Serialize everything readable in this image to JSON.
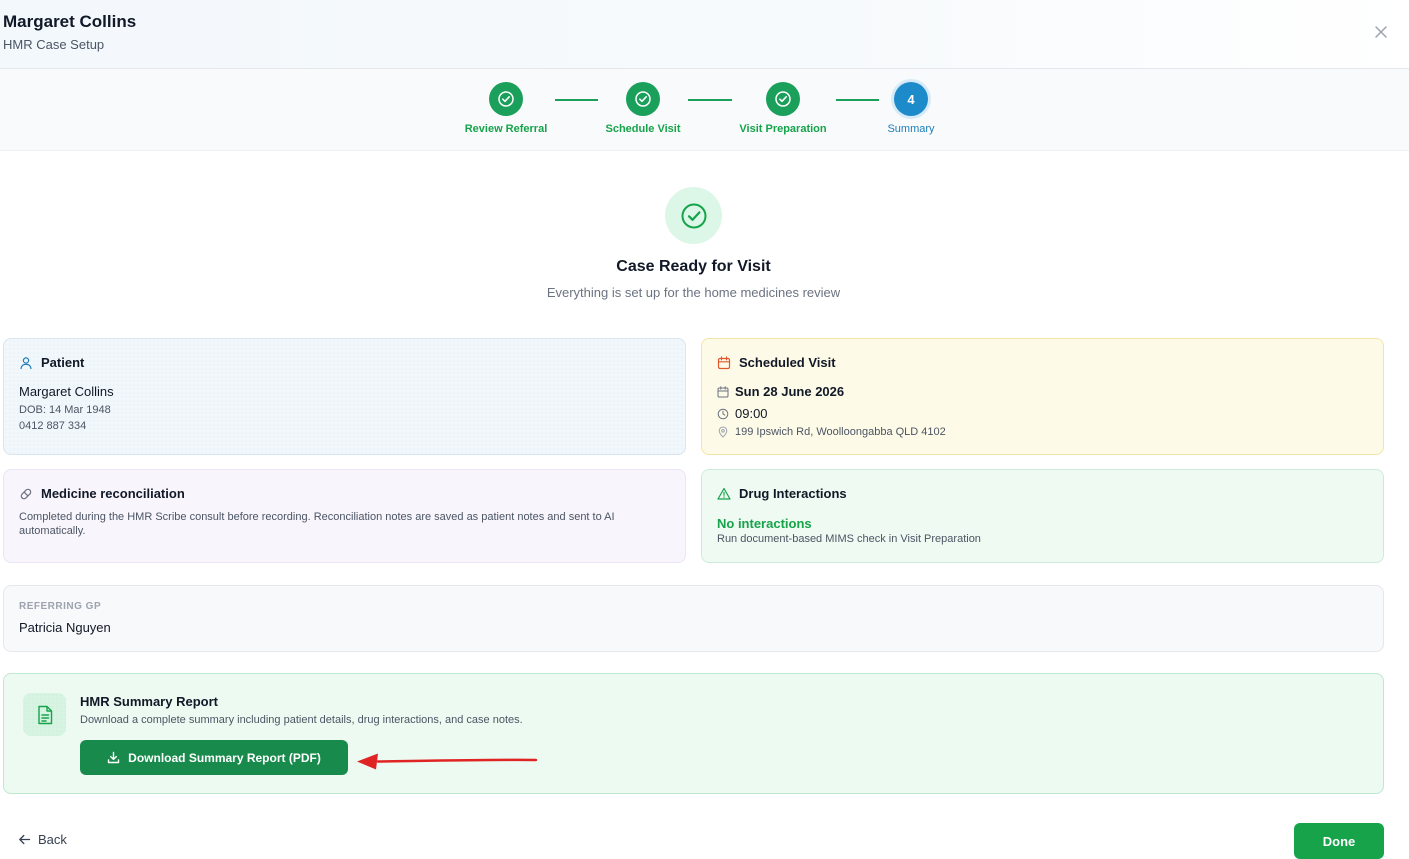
{
  "header": {
    "patient_name": "Margaret Collins",
    "subtitle": "HMR Case Setup"
  },
  "stepper": {
    "steps": [
      {
        "label": "Review Referral",
        "status": "complete"
      },
      {
        "label": "Schedule Visit",
        "status": "complete"
      },
      {
        "label": "Visit Preparation",
        "status": "complete"
      },
      {
        "label": "Summary",
        "status": "active",
        "number": "4"
      }
    ]
  },
  "hero": {
    "title": "Case Ready for Visit",
    "subtitle": "Everything is set up for the home medicines review"
  },
  "patient_card": {
    "title": "Patient",
    "name": "Margaret Collins",
    "dob": "DOB: 14 Mar 1948",
    "phone": "0412 887 334"
  },
  "visit_card": {
    "title": "Scheduled Visit",
    "date": "Sun 28 June 2026",
    "time": "09:00",
    "address": "199 Ipswich Rd, Woolloongabba QLD 4102"
  },
  "reconciliation_card": {
    "title": "Medicine reconciliation",
    "body": "Completed during the HMR Scribe consult before recording. Reconciliation notes are saved as patient notes and sent to AI automatically."
  },
  "drug_card": {
    "title": "Drug Interactions",
    "status": "No interactions",
    "hint": "Run document-based MIMS check in Visit Preparation"
  },
  "gp_card": {
    "label": "REFERRING GP",
    "name": "Patricia Nguyen"
  },
  "report_card": {
    "title": "HMR Summary Report",
    "description": "Download a complete summary including patient details, drug interactions, and case notes.",
    "button_label": "Download Summary Report (PDF)"
  },
  "footer": {
    "back_label": "Back",
    "done_label": "Done"
  },
  "colors": {
    "success": "#16a34a",
    "active_step": "#1d8bc9",
    "annotation_arrow": "#e02424"
  }
}
